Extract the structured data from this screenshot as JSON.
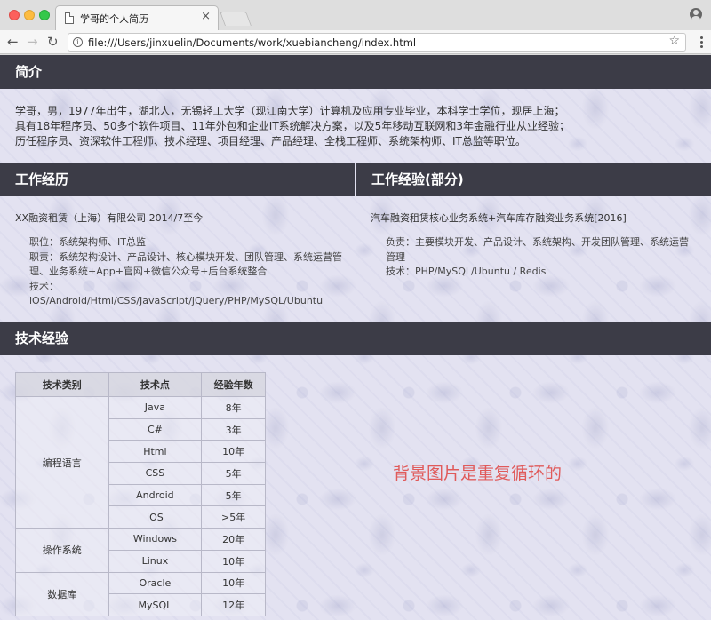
{
  "browser": {
    "tab_title": "学哥的个人简历",
    "tab_close": "×",
    "url": "file:///Users/jinxuelin/Documents/work/xuebiancheng/index.html",
    "back_glyph": "←",
    "forward_glyph": "→",
    "reload_glyph": "↻",
    "info_glyph": "i",
    "star_glyph": "☆",
    "icons": [
      "document-icon",
      "close-icon",
      "profile-icon",
      "back-arrow-icon",
      "forward-arrow-icon",
      "reload-icon",
      "info-icon",
      "star-icon",
      "menu-kebab-icon"
    ]
  },
  "intro": {
    "heading": "简介",
    "lines": [
      "学哥，男，1977年出生，湖北人，无锡轻工大学（现江南大学）计算机及应用专业毕业，本科学士学位，现居上海；",
      "具有18年程序员、50多个软件项目、11年外包和企业IT系统解决方案，以及5年移动互联网和3年金融行业从业经验；",
      "历任程序员、资深软件工程师、技术经理、项目经理、产品经理、全栈工程师、系统架构师、IT总监等职位。"
    ]
  },
  "work_history": {
    "heading": "工作经历",
    "company": "XX融资租赁（上海）有限公司 2014/7至今",
    "details": [
      "职位：系统架构师、IT总监",
      "职责：系统架构设计、产品设计、核心模块开发、团队管理、系统运营管理、业务系统+App+官网+微信公众号+后台系统整合",
      "技术：iOS/Android/Html/CSS/JavaScript/jQuery/PHP/MySQL/Ubuntu"
    ]
  },
  "work_experience": {
    "heading": "工作经验(部分)",
    "project": "汽车融资租赁核心业务系统+汽车库存融资业务系统[2016]",
    "details": [
      "负责：主要模块开发、产品设计、系统架构、开发团队管理、系统运营管理",
      "技术：PHP/MySQL/Ubuntu / Redis"
    ]
  },
  "tech": {
    "heading": "技术经验",
    "columns": [
      "技术类别",
      "技术点",
      "经验年数"
    ],
    "groups": [
      {
        "category": "编程语言",
        "rows": [
          [
            "Java",
            "8年"
          ],
          [
            "C#",
            "3年"
          ],
          [
            "Html",
            "10年"
          ],
          [
            "CSS",
            "5年"
          ],
          [
            "Android",
            "5年"
          ],
          [
            "iOS",
            ">5年"
          ]
        ]
      },
      {
        "category": "操作系统",
        "rows": [
          [
            "Windows",
            "20年"
          ],
          [
            "Linux",
            "10年"
          ]
        ]
      },
      {
        "category": "数据库",
        "rows": [
          [
            "Oracle",
            "10年"
          ],
          [
            "MySQL",
            "12年"
          ]
        ]
      }
    ],
    "note": "背景图片是重复循环的"
  },
  "colors": {
    "header_bar": "#3c3c47",
    "page_bg": "#e3e2f1",
    "note": "#e05a5a"
  }
}
